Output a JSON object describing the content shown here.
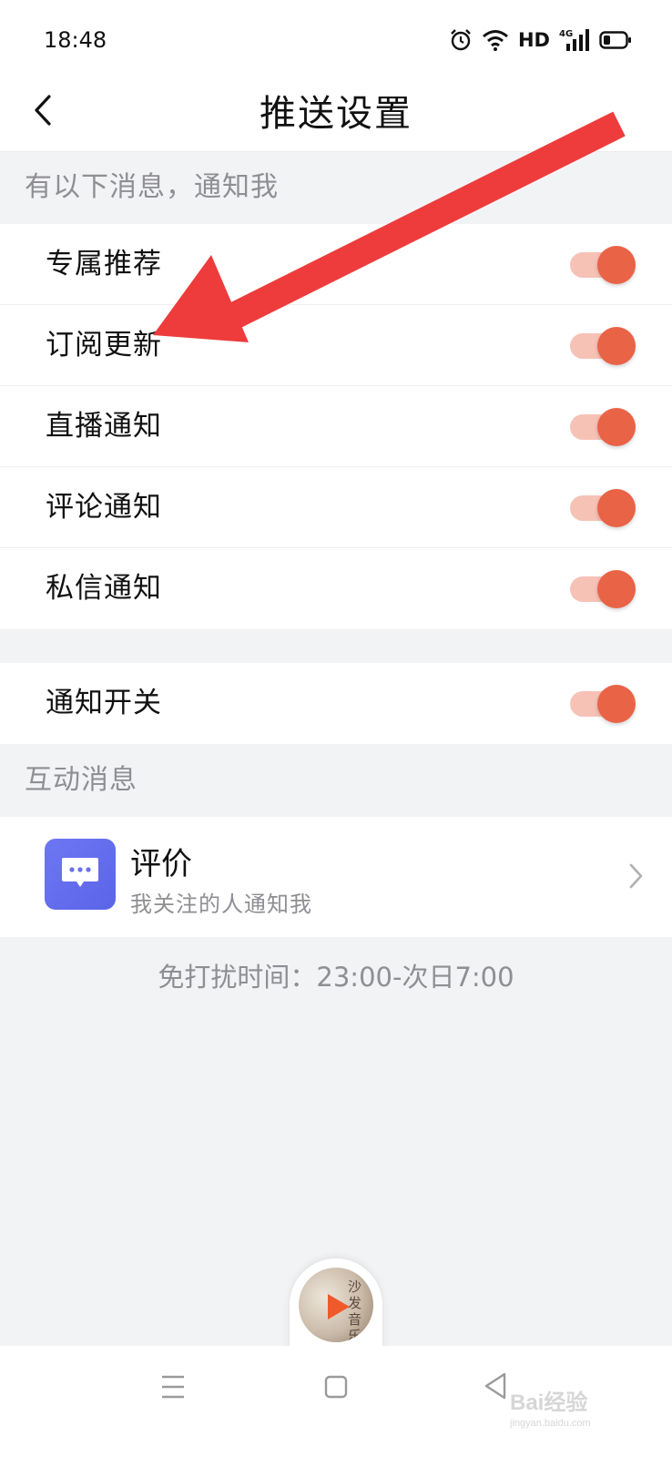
{
  "status_bar": {
    "time": "18:48",
    "network_label": "HD",
    "signal_label": "4G",
    "icons": [
      "alarm-icon",
      "wifi-icon",
      "cellular-signal-icon",
      "battery-icon"
    ]
  },
  "header": {
    "title": "推送设置",
    "back_icon": "chevron-left-icon"
  },
  "notify_section": {
    "header": "有以下消息，通知我",
    "items": [
      {
        "label": "专属推荐",
        "enabled": true
      },
      {
        "label": "订阅更新",
        "enabled": true
      },
      {
        "label": "直播通知",
        "enabled": true
      },
      {
        "label": "评论通知",
        "enabled": true
      },
      {
        "label": "私信通知",
        "enabled": true
      }
    ]
  },
  "master_switch": {
    "label": "通知开关",
    "enabled": true
  },
  "interaction_section": {
    "header": "互动消息",
    "review": {
      "title": "评价",
      "subtitle": "我关注的人通知我",
      "icon": "chat-bubble-icon"
    }
  },
  "do_not_disturb": "免打扰时间：23:00-次日7:00",
  "music_player": {
    "cover_text": "沙发音乐",
    "icon": "play-icon"
  },
  "bottom_nav": {
    "icons": [
      "menu-icon",
      "home-icon",
      "back-triangle-icon"
    ]
  },
  "watermark": {
    "text": "Bai经验",
    "sub": "jingyan.baidu.com"
  },
  "colors": {
    "accent": "#e96346",
    "toggle_track": "#f7c2b6",
    "annotation_arrow": "#ee3b3b",
    "review_icon_bg": "#6770ef"
  }
}
